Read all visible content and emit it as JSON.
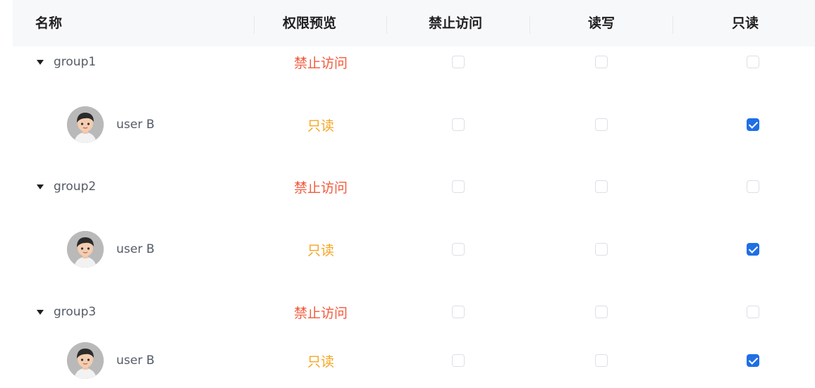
{
  "columns": {
    "name": "名称",
    "preview": "权限预览",
    "deny": "禁止访问",
    "read_write": "读写",
    "read_only": "只读"
  },
  "colors": {
    "deny_text": "#f15a3c",
    "read_only_text": "#f5a623",
    "checkbox_checked": "#1f6fe5",
    "header_bg": "#f7f8fa"
  },
  "groups": [
    {
      "name": "group1",
      "preview": "禁止访问",
      "deny": false,
      "read_write": false,
      "read_only": false,
      "users": [
        {
          "name": "user B",
          "avatar": "person-avatar-icon",
          "preview": "只读",
          "deny": false,
          "read_write": false,
          "read_only": true
        }
      ]
    },
    {
      "name": "group2",
      "preview": "禁止访问",
      "deny": false,
      "read_write": false,
      "read_only": false,
      "users": [
        {
          "name": "user B",
          "avatar": "person-avatar-icon",
          "preview": "只读",
          "deny": false,
          "read_write": false,
          "read_only": true
        }
      ]
    },
    {
      "name": "group3",
      "preview": "禁止访问",
      "deny": false,
      "read_write": false,
      "read_only": false,
      "users": [
        {
          "name": "user B",
          "avatar": "person-avatar-icon",
          "preview": "只读",
          "deny": false,
          "read_write": false,
          "read_only": true
        }
      ]
    }
  ]
}
